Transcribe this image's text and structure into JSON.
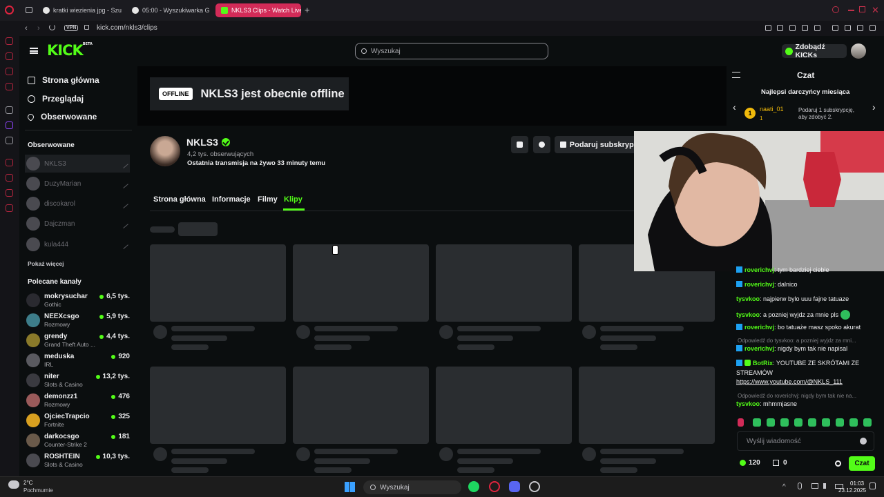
{
  "browser": {
    "tabs": [
      {
        "title": "kratki wiezienia jpg - Szuk"
      },
      {
        "title": "05:00 - Wyszukiwarka G"
      },
      {
        "title": "NKLS3 Clips - Watch Live"
      }
    ],
    "new_tab": "+",
    "url": "kick.com/nkls3/clips",
    "vpn_label": "VPN"
  },
  "header": {
    "logo": "KICK",
    "logo_sup": "BETA",
    "search_placeholder": "Wyszukaj",
    "kicks_button": "Zdobądź KICKs"
  },
  "sidebar": {
    "nav": [
      {
        "label": "Strona główna",
        "icon": "home-icon"
      },
      {
        "label": "Przeglądaj",
        "icon": "compass-icon"
      },
      {
        "label": "Obserwowane",
        "icon": "heart-icon"
      }
    ],
    "followed_title": "Obserwowane",
    "followed": [
      "NKLS3",
      "DuzyMarian",
      "discokarol",
      "Dajczman",
      "kula444"
    ],
    "show_more": "Pokaż więcej",
    "recommended_title": "Polecane kanały",
    "recommended": [
      {
        "name": "mokrysuchar",
        "category": "Gothic",
        "viewers": "6,5 tys."
      },
      {
        "name": "NEEXcsgo",
        "category": "Rozmowy",
        "viewers": "5,9 tys."
      },
      {
        "name": "grendy",
        "category": "Grand Theft Auto ...",
        "viewers": "4,4 tys."
      },
      {
        "name": "meduska",
        "category": "IRL",
        "viewers": "920"
      },
      {
        "name": "niter",
        "category": "Slots & Casino",
        "viewers": "13,2 tys."
      },
      {
        "name": "demonzz1",
        "category": "Rozmowy",
        "viewers": "476"
      },
      {
        "name": "OjciecTrapcio",
        "category": "Fortnite",
        "viewers": "325"
      },
      {
        "name": "darkocsgo",
        "category": "Counter-Strike 2",
        "viewers": "181"
      },
      {
        "name": "ROSHTEIN",
        "category": "Slots & Casino",
        "viewers": "10,3 tys."
      }
    ]
  },
  "banner": {
    "badge": "OFFLINE",
    "text": "NKLS3 jest obecnie offline"
  },
  "channel": {
    "name": "NKLS3",
    "followers": "4,2 tys. obserwujących",
    "last_stream": "Ostatnia transmisja na żywo 33 minuty temu",
    "gift_sub": "Podaruj subskrypcję"
  },
  "channel_tabs": [
    "Strona główna",
    "Informacje",
    "Filmy",
    "Klipy"
  ],
  "chat": {
    "title": "Czat",
    "top_gifters": "Najlepsi darczyńcy miesiąca",
    "gifter_name": "naati_01",
    "gifter_count": "1",
    "gifter_rank": "1",
    "gifter_cta": "Podaruj 1 subskrypcję, aby zdobyć 2.",
    "messages": [
      {
        "user": "roverichvj",
        "text": ": tym bardziej ciebie"
      },
      {
        "user": "roverichvj",
        "text": ": dalnico"
      },
      {
        "user": "tysvkoo",
        "text": ": najpierw bylo uuu fajne tatuaze"
      },
      {
        "user": "tysvkoo",
        "text": ": a pozniej wyjdz za mnie pls"
      },
      {
        "user": "roverichvj",
        "text": ": bo tatuaże masz spoko akurat"
      },
      {
        "reply": "Odpowiedź do tysvkoo: a pozniej wyjdz za mni..."
      },
      {
        "user": "roverichvj",
        "text": ": nigdy bym tak nie napisal"
      },
      {
        "user": "BotRix",
        "text": ": YOUTUBE ZE SKRÓTAMI ZE"
      },
      {
        "text": "STREAMÓW"
      },
      {
        "link": "https://www.youtube.com/@NKLS_111"
      },
      {
        "reply": "Odpowiedź do roverichvj: nigdy bym tak nie na..."
      },
      {
        "user": "tysvkoo",
        "text": ": mhmmjasne"
      }
    ],
    "input_placeholder": "Wyślij wiadomość",
    "points": "120",
    "gifts": "0",
    "send_label": "Czat"
  },
  "taskbar": {
    "weather_temp": "2°C",
    "weather_desc": "Pochmurnie",
    "search": "Wyszukaj",
    "time": "01:03",
    "date": "23.12.2025"
  },
  "colors": {
    "accent": "#53fc18",
    "background": "#0b0e0f",
    "surface": "#25282b",
    "skeleton": "#2a2d30",
    "tab_active": "#d22b58"
  }
}
